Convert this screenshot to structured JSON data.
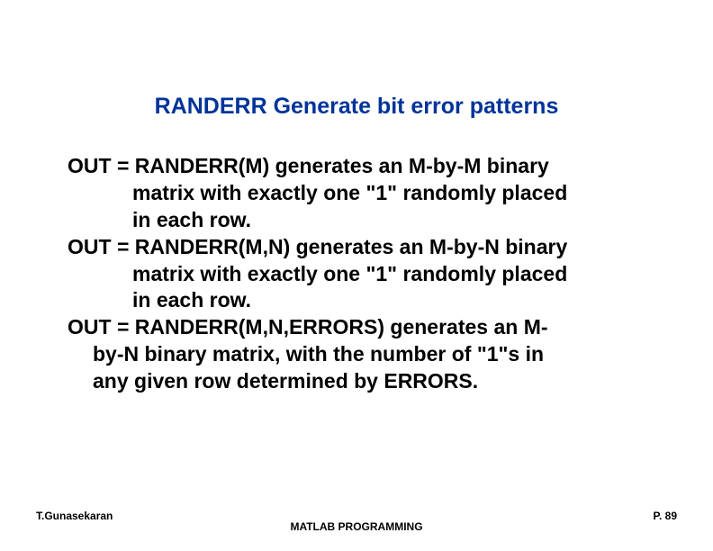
{
  "title": "RANDERR Generate bit error patterns",
  "body": {
    "p1_l1": "OUT = RANDERR(M) generates an M-by-M binary",
    "p1_l2": "matrix with exactly one \"1\" randomly placed",
    "p1_l3": "in each row.",
    "p2_l1": "OUT = RANDERR(M,N) generates an M-by-N binary",
    "p2_l2": "matrix with exactly one \"1\" randomly placed",
    "p2_l3": "in each row.",
    "p3_l1": "OUT = RANDERR(M,N,ERRORS) generates an M-",
    "p3_l2": "by-N binary matrix, with the number of \"1\"s in",
    "p3_l3": "any given row determined by ERRORS."
  },
  "footer": {
    "author": "T.Gunasekaran",
    "center": "MATLAB PROGRAMMING",
    "page": "P. 89"
  }
}
